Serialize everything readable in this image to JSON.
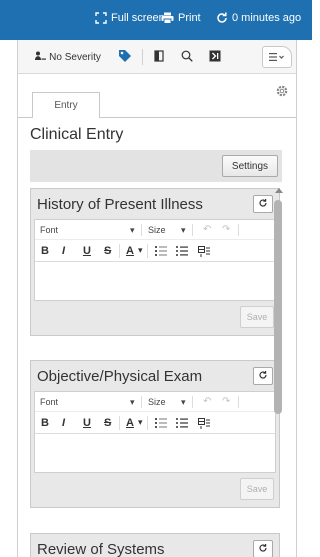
{
  "topbar": {
    "fullscreen_label": "Full screen",
    "print_label": "Print",
    "refresh_label": "0 minutes ago",
    "background_color": "#1f70b0"
  },
  "toolbar": {
    "severity_label": "No Severity",
    "icons": [
      "user-list-icon",
      "tag-icon",
      "column-icon",
      "search-icon",
      "next-icon",
      "menu-icon"
    ]
  },
  "tabs": [
    {
      "label": "Entry",
      "active": true
    }
  ],
  "section_title": "Clinical Entry",
  "settings_label": "Settings",
  "rte": {
    "font_label": "Font",
    "size_label": "Size",
    "bold": "B",
    "italic": "I",
    "underline": "U",
    "strike": "S",
    "font_color": "A"
  },
  "notes": [
    {
      "title": "History of Present Illness",
      "save_label": "Save"
    },
    {
      "title": "Objective/Physical Exam",
      "save_label": "Save"
    },
    {
      "title": "Review of Systems"
    }
  ]
}
